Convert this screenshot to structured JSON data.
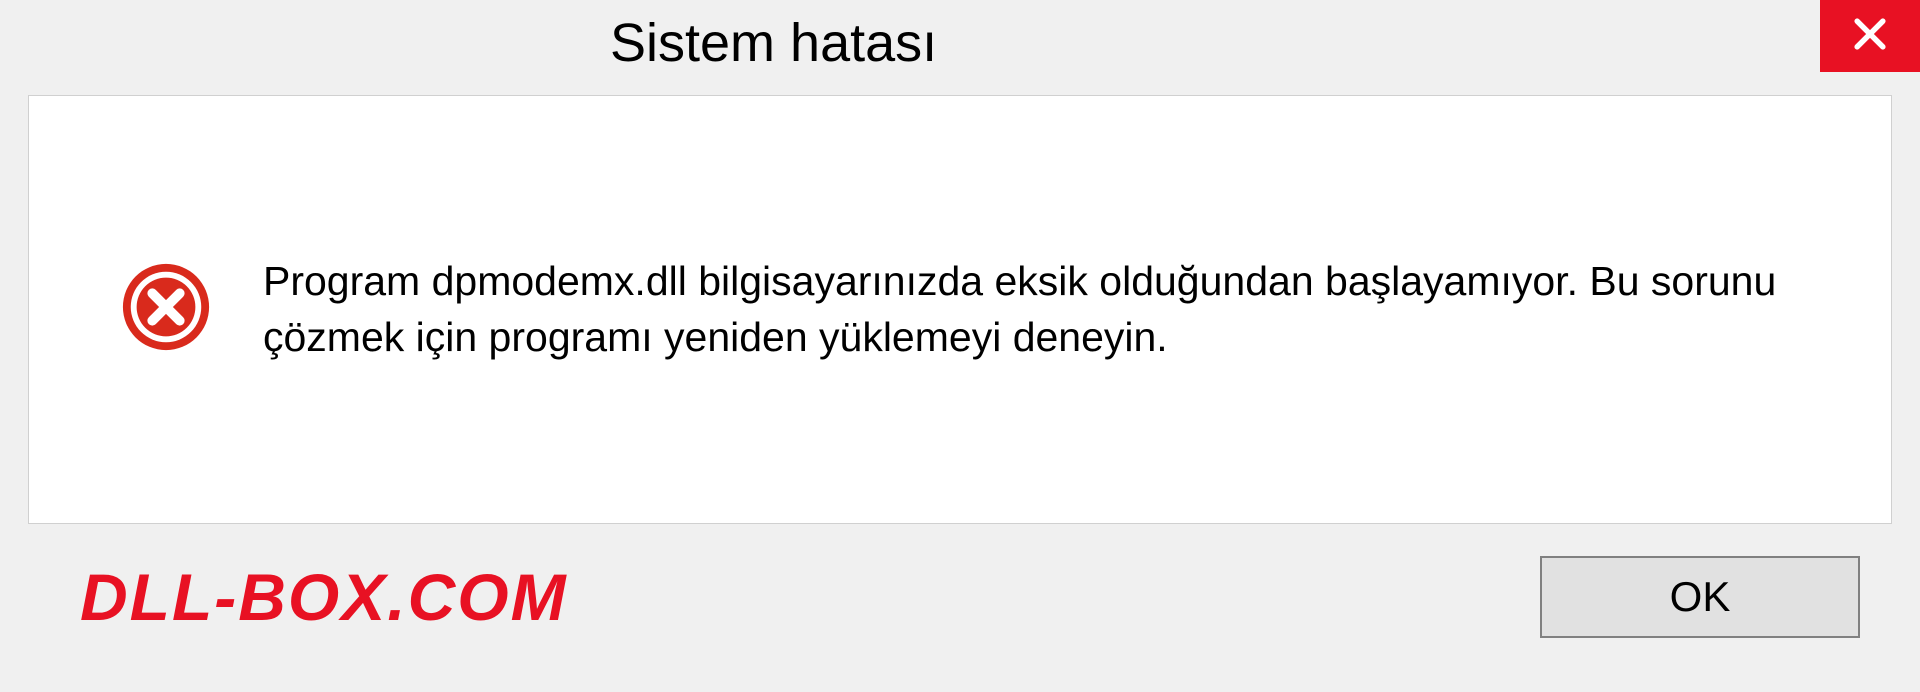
{
  "dialog": {
    "title": "Sistem hatası",
    "message": "Program dpmodemx.dll bilgisayarınızda eksik olduğundan başlayamıyor. Bu sorunu çözmek için programı yeniden yüklemeyi deneyin.",
    "ok_label": "OK"
  },
  "watermark": "DLL-BOX.COM",
  "colors": {
    "close_red": "#e81123",
    "watermark_red": "#e81123"
  }
}
